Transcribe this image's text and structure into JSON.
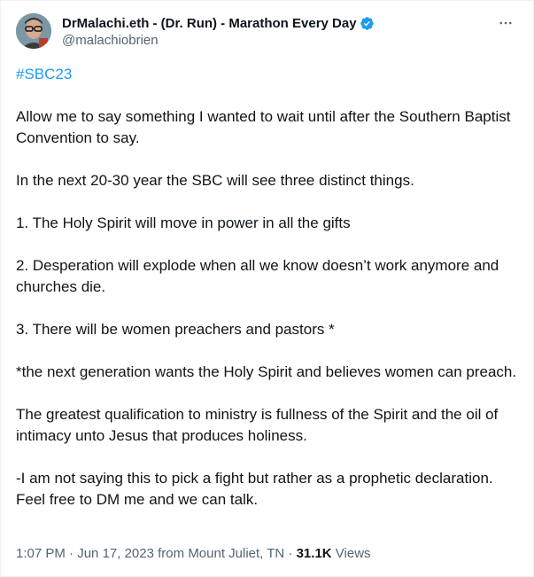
{
  "author": {
    "display_name": "DrMalachi.eth - (Dr. Run) - Marathon Every Day",
    "handle": "@malachiobrien"
  },
  "icons": {
    "avatar": "avatar",
    "verified": "verified-badge-icon",
    "more": "more-options-icon"
  },
  "colors": {
    "accent": "#1d9bf0",
    "text": "#0f1419",
    "secondary": "#536471"
  },
  "tweet": {
    "hashtag": "#SBC23",
    "paragraphs": [
      "Allow me to say something I wanted to wait until after the Southern Baptist Convention to say.",
      "In the next 20-30 year the SBC will see three distinct things.",
      "1. The Holy Spirit will move in power in all the gifts",
      "2. Desperation will explode when all we know doesn’t work anymore and churches die.",
      "3. There will be women preachers and pastors *",
      "*the next generation wants the Holy Spirit and believes women can preach.",
      "The greatest qualification to ministry is fullness of the Spirit and the oil of intimacy unto Jesus that produces holiness.",
      "-I am not saying this to pick a fight but rather as a prophetic declaration. Feel free to DM me and we can talk."
    ]
  },
  "meta": {
    "time": "1:07 PM",
    "separator": " · ",
    "date": "Jun 17, 2023",
    "from": " from ",
    "location": "Mount Juliet, TN",
    "separator2": " · ",
    "views_count": "31.1K",
    "views_label": " Views"
  }
}
